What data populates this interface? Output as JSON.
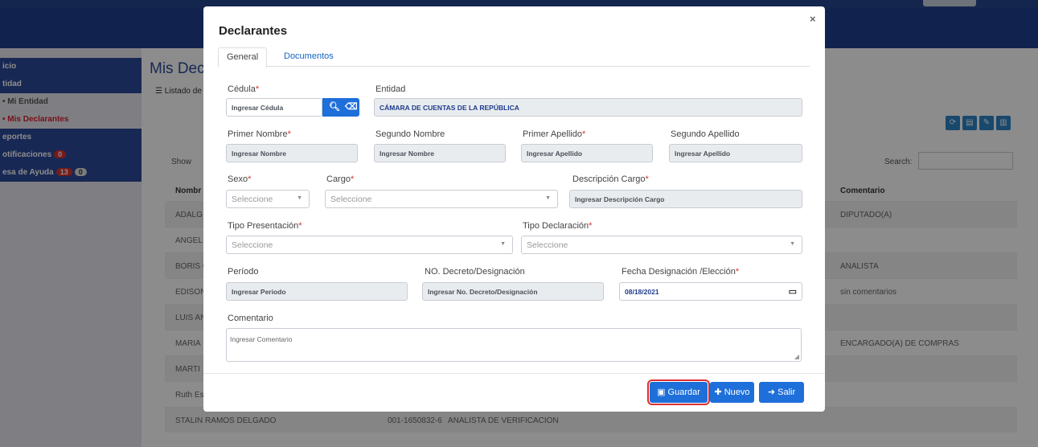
{
  "background": {
    "sidebar": {
      "items": [
        {
          "label": "icio",
          "style": "dark"
        },
        {
          "label": "tidad",
          "style": "dark"
        },
        {
          "label": "• Mi Entidad",
          "style": "light"
        },
        {
          "label": "• Mis Declarantes",
          "style": "red"
        },
        {
          "label": "eportes",
          "style": "dark"
        },
        {
          "label": "otificaciones",
          "style": "dark",
          "badge": "0"
        },
        {
          "label": "esa de Ayuda",
          "style": "dark",
          "badge": "13",
          "badge2": "0"
        }
      ]
    },
    "page_title": "Mis Dec",
    "listado": "☰ Listado de",
    "show_label": "Show",
    "search_label": "Search:",
    "table": {
      "header_nombre": "Nombr",
      "header_comentario": "Comentario",
      "rows": [
        {
          "nombre": "ADALG",
          "comentario": "DIPUTADO(A)"
        },
        {
          "nombre": "ANGEL",
          "comentario": ""
        },
        {
          "nombre": "BORIS G",
          "comentario": "ANALISTA"
        },
        {
          "nombre": "EDISON",
          "comentario": "sin comentarios"
        },
        {
          "nombre": "LUIS AN",
          "comentario": ""
        },
        {
          "nombre": "MARIA",
          "comentario": "ENCARGADO(A) DE COMPRAS"
        },
        {
          "nombre": "MARTI",
          "comentario": ""
        },
        {
          "nombre": "Ruth Es",
          "comentario": ""
        },
        {
          "nombre": "STALIN RAMOS DELGADO",
          "cedula": "001-1650832-6",
          "cargo": "ANALISTA DE VERIFICACION",
          "comentario": ""
        }
      ]
    }
  },
  "modal": {
    "title": "Declarantes",
    "close": "×",
    "tabs": [
      "General",
      "Documentos"
    ],
    "cedula": {
      "label": "Cédula",
      "placeholder": "Ingresar Cédula"
    },
    "entidad": {
      "label": "Entidad",
      "value": "CÁMARA DE CUENTAS DE LA REPÚBLICA"
    },
    "primer_nombre": {
      "label": "Primer Nombre",
      "placeholder": "Ingresar Nombre"
    },
    "segundo_nombre": {
      "label": "Segundo Nombre",
      "placeholder": "Ingresar Nombre"
    },
    "primer_apellido": {
      "label": "Primer Apellido",
      "placeholder": "Ingresar Apellido"
    },
    "segundo_apellido": {
      "label": "Segundo Apellido",
      "placeholder": "Ingresar Apellido"
    },
    "sexo": {
      "label": "Sexo",
      "value": "Seleccione"
    },
    "cargo": {
      "label": "Cargo",
      "value": "Seleccione"
    },
    "descripcion_cargo": {
      "label": "Descripción Cargo",
      "placeholder": "Ingresar Descripción Cargo"
    },
    "tipo_presentacion": {
      "label": "Tipo Presentación",
      "value": "Seleccione"
    },
    "tipo_declaracion": {
      "label": "Tipo Declaración",
      "value": "Seleccione"
    },
    "periodo": {
      "label": "Período",
      "placeholder": "Ingresar Periodo"
    },
    "decreto": {
      "label": "NO. Decreto/Designación",
      "placeholder": "Ingresar No. Decreto/Designación"
    },
    "fecha": {
      "label": "Fecha Designación /Elección",
      "value": "08/18/2021"
    },
    "comentario": {
      "label": "Comentario",
      "placeholder": "Ingresar Comentario"
    },
    "buttons": {
      "guardar": "Guardar",
      "nuevo": "Nuevo",
      "salir": "Salir"
    }
  }
}
